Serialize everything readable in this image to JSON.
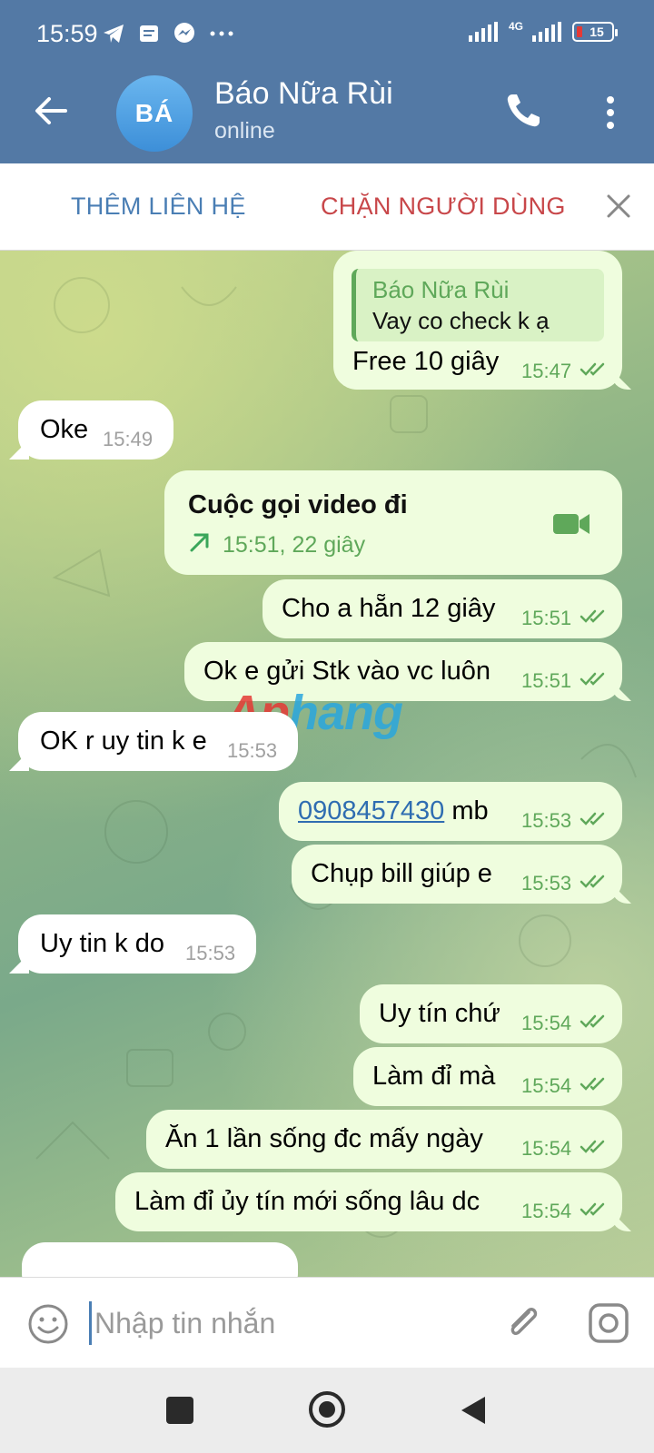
{
  "status_bar": {
    "time": "15:59",
    "icons": [
      "telegram-icon",
      "message-icon",
      "messenger-icon",
      "more-dots-icon"
    ],
    "network": "4G",
    "battery": "15"
  },
  "header": {
    "avatar_initials": "BÁ",
    "contact_name": "Báo Nữa Rùi",
    "contact_status": "online"
  },
  "action_bar": {
    "add_contact": "THÊM LIÊN HỆ",
    "block_user": "CHẶN NGƯỜI DÙNG"
  },
  "messages": {
    "m1_reply_name": "Báo Nữa Rùi",
    "m1_reply_text": "Vay co check k ạ",
    "m1_text": "Free 10 giây",
    "m1_time": "15:47",
    "m2_text": "Oke",
    "m2_time": "15:49",
    "m3_call_title": "Cuộc gọi video đi",
    "m3_call_detail": "15:51, 22 giây",
    "m4_text": "Cho a hẵn 12 giây",
    "m4_time": "15:51",
    "m5_text": "Ok e gửi Stk vào vc luôn",
    "m5_time": "15:51",
    "m6_text": "OK r uy tin k e",
    "m6_time": "15:53",
    "m7_phone": "0908457430",
    "m7_suffix": " mb",
    "m7_time": "15:53",
    "m8_text": "Chụp bill giúp e",
    "m8_time": "15:53",
    "m9_text": "Uy tin k do",
    "m9_time": "15:53",
    "m10_text": "Uy tín chứ",
    "m10_time": "15:54",
    "m11_text": "Làm đỉ mà",
    "m11_time": "15:54",
    "m12_text": "Ăn 1 lần sống đc mấy ngày",
    "m12_time": "15:54",
    "m13_text": "Làm đỉ ủy tín mới sống lâu dc",
    "m13_time": "15:54"
  },
  "watermark": {
    "part1": "Ap",
    "part2": "hang"
  },
  "input": {
    "placeholder": "Nhập tin nhắn"
  },
  "colors": {
    "header": "#5379a5",
    "outgoing_bubble": "#effdde",
    "incoming_bubble": "#ffffff",
    "accent_green": "#5fa85a",
    "block_red": "#c8474a"
  }
}
